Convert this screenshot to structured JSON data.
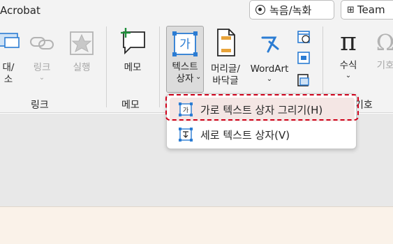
{
  "titlebar": {
    "tab_label": "Acrobat",
    "record_label": "녹음/녹화",
    "teams_label": "Team"
  },
  "ribbon": {
    "buttons": {
      "table_label": "대/\n소",
      "link_label": "링크",
      "action_label": "실행",
      "memo_label": "메모",
      "textbox_label": "텍스트\n상자",
      "header_footer_label": "머리글/\n바닥글",
      "wordart_label": "WordArt",
      "equation_label": "수식",
      "symbol_label": "기호"
    },
    "groups": {
      "link_group": "링크",
      "memo_group": "메모",
      "symbol_group": "기호"
    }
  },
  "dropdown": {
    "horizontal_label": "가로 텍스트 상자 그리기(H)",
    "vertical_label": "세로 텍스트 상자(V)"
  },
  "colors": {
    "accent_blue": "#2b7cd3",
    "highlight_red": "#d0021b",
    "icon_green": "#1e8f3a",
    "icon_orange": "#e8a33a"
  }
}
